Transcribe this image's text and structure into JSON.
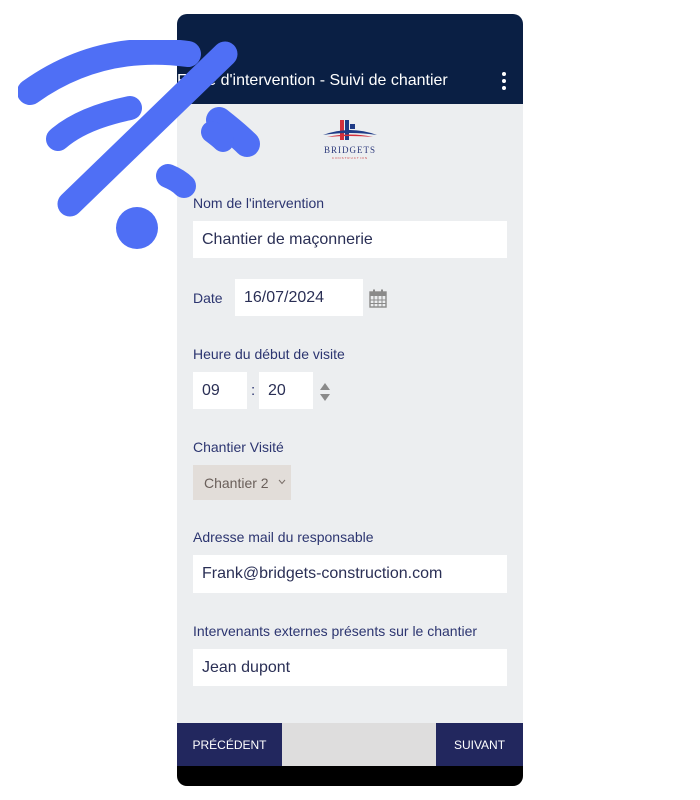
{
  "header": {
    "title": "Fiche d'intervention - Suivi de chantier",
    "menu_icon": "more-vert-icon"
  },
  "logo": {
    "name": "BRIDGETS",
    "subtitle": "CONSTRUCTION"
  },
  "form": {
    "intervention_name": {
      "label": "Nom de l'intervention",
      "value": "Chantier de maçonnerie"
    },
    "date": {
      "label": "Date",
      "value": "16/07/2024",
      "icon": "calendar-icon"
    },
    "start_time": {
      "label": "Heure du début de visite",
      "hours": "09",
      "separator": ":",
      "minutes": "20",
      "icon": "spinner-arrows-icon"
    },
    "site": {
      "label": "Chantier Visité",
      "selected": "Chantier 2"
    },
    "manager_email": {
      "label": "Adresse mail du responsable",
      "value": "Frank@bridgets-construction.com"
    },
    "external_staff": {
      "label": "Intervenants externes présents sur le chantier",
      "value": "Jean dupont"
    }
  },
  "footer": {
    "previous_label": "PRÉCÉDENT",
    "next_label": "SUIVANT"
  },
  "overlay": {
    "icon": "wifi-off-icon",
    "color": "#4f6ff5"
  },
  "colors": {
    "header_bg": "#0a1f44",
    "nav_button_bg": "#22275e",
    "form_bg": "#eceef0",
    "label_text": "#2c3570"
  }
}
